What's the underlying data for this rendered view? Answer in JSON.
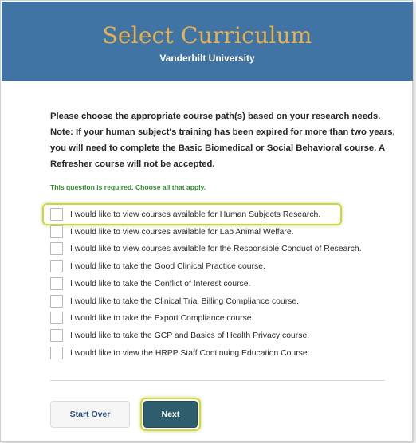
{
  "header": {
    "title": "Select Curriculum",
    "subtitle": "Vanderbilt University"
  },
  "question": {
    "text": "Please choose the appropriate course path(s) based on your research needs. Note: If your human subject's training has been expired for more than two years, you will need to complete the Basic Biomedical or Social Behavioral course. A Refresher course will not be accepted.",
    "required_note": "This question is required. Choose all that apply."
  },
  "options": [
    {
      "label": "I would like to view courses available for Human Subjects Research.",
      "checked": false,
      "highlighted": true
    },
    {
      "label": "I would like to view courses available for Lab Animal Welfare.",
      "checked": false
    },
    {
      "label": "I would like to view courses available for the Responsible Conduct of Research.",
      "checked": false
    },
    {
      "label": "I would like to take the Good Clinical Practice course.",
      "checked": false
    },
    {
      "label": "I would like to take the Conflict of Interest course.",
      "checked": false
    },
    {
      "label": "I would like to take the Clinical Trial Billing Compliance course.",
      "checked": false
    },
    {
      "label": "I would like to take the Export Compliance course.",
      "checked": false
    },
    {
      "label": "I would like to take the GCP and Basics of Health Privacy course.",
      "checked": false
    },
    {
      "label": "I would like to view the HRPP Staff Continuing Education Course.",
      "checked": false
    }
  ],
  "buttons": {
    "start_over": "Start Over",
    "next": "Next"
  },
  "colors": {
    "header_bg": "#3f74a4",
    "title": "#e8b04a",
    "required_text": "#2e8b2e",
    "highlight": "#cfd83a",
    "next_bg": "#2e5e6e"
  }
}
